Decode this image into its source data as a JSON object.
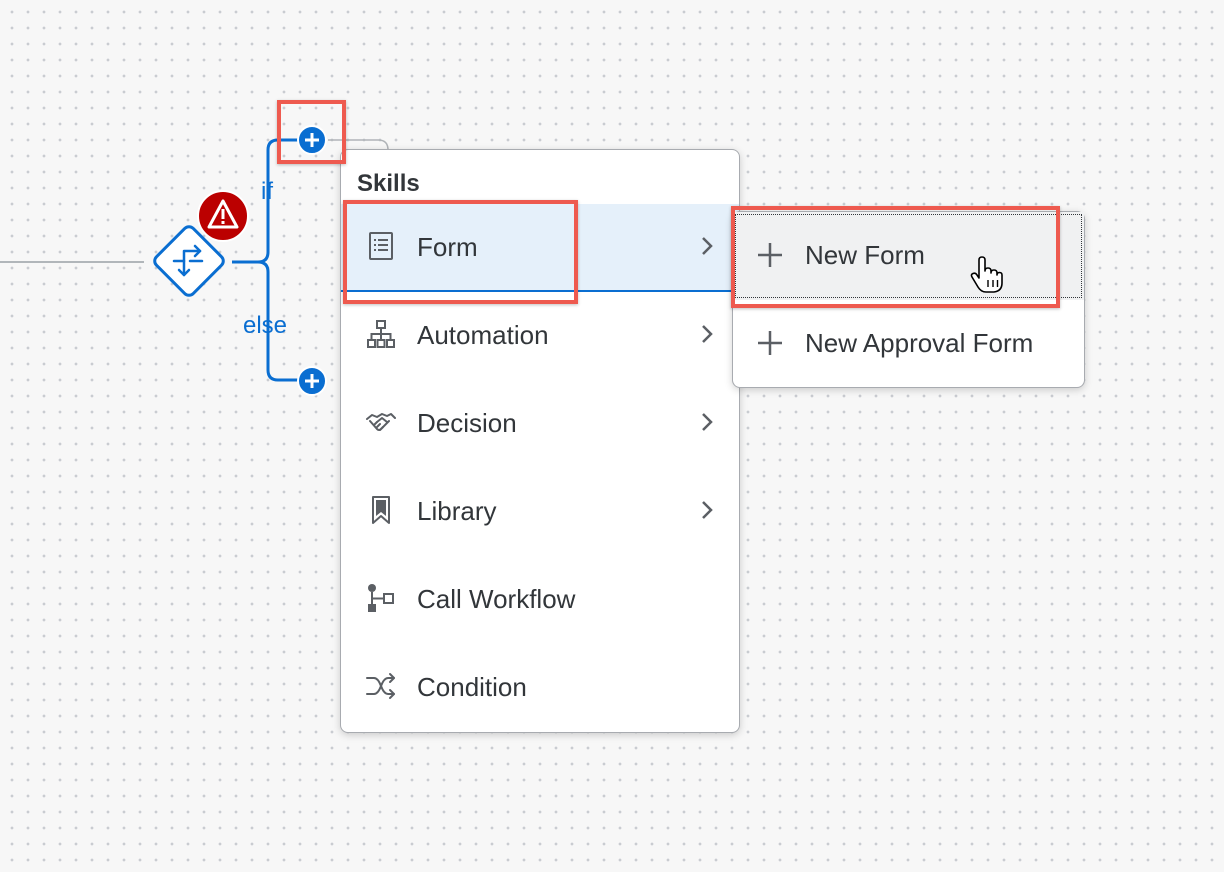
{
  "canvas": {
    "branch_if_label": "if",
    "branch_else_label": "else",
    "gateway_icon": "condition-gateway-icon",
    "error_icon": "warning-icon",
    "accent_color": "#0a6ed1",
    "error_color": "#bb0000",
    "highlight_color": "#ee5a4f"
  },
  "menu": {
    "header": "Skills",
    "items": [
      {
        "label": "Form",
        "icon": "form-icon",
        "has_submenu": true,
        "selected": true
      },
      {
        "label": "Automation",
        "icon": "hierarchy-icon",
        "has_submenu": true
      },
      {
        "label": "Decision",
        "icon": "handshake-icon",
        "has_submenu": true
      },
      {
        "label": "Library",
        "icon": "bookmark-icon",
        "has_submenu": true
      },
      {
        "label": "Call Workflow",
        "icon": "workflow-icon",
        "has_submenu": false
      },
      {
        "label": "Condition",
        "icon": "shuffle-icon",
        "has_submenu": false
      }
    ]
  },
  "submenu": {
    "items": [
      {
        "label": "New Form",
        "icon": "plus-icon",
        "focused": true
      },
      {
        "label": "New Approval Form",
        "icon": "plus-icon"
      }
    ]
  }
}
